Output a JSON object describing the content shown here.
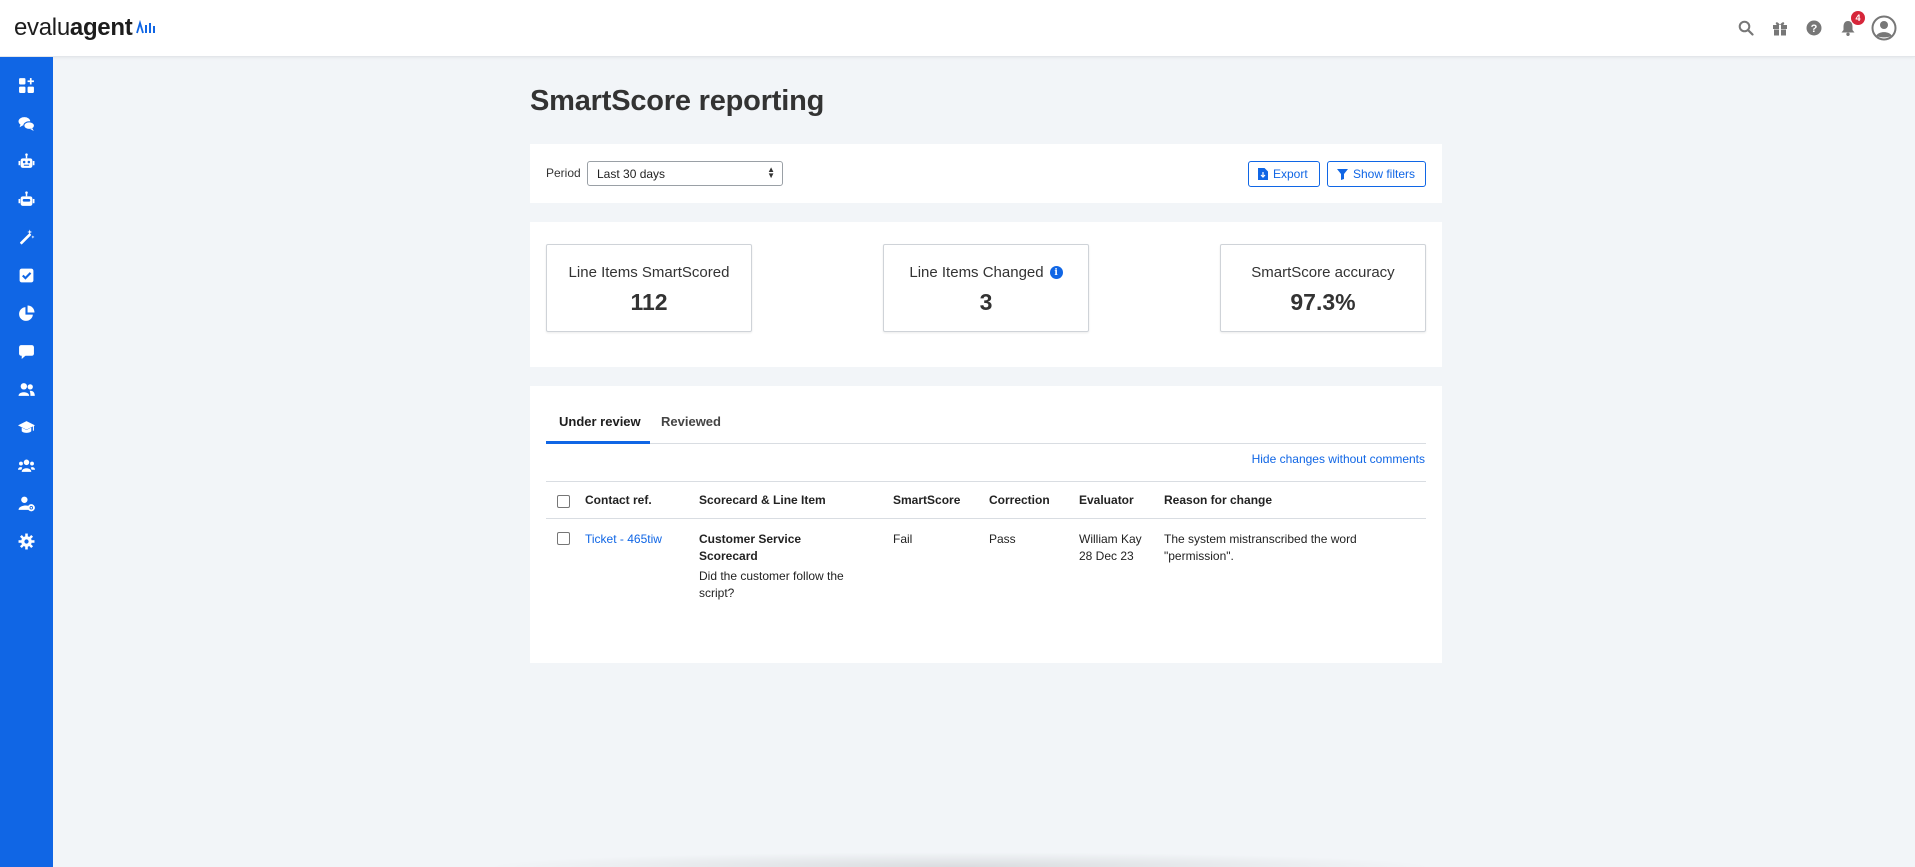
{
  "app": {
    "logo_text_regular": "evalu",
    "logo_text_bold": "agent",
    "brand_color": "#1066e5",
    "notification_count": "4"
  },
  "topbar": {
    "icons": [
      "search-icon",
      "gift-icon",
      "help-icon",
      "bell-icon",
      "user-avatar-icon"
    ]
  },
  "sidebar": {
    "items": [
      {
        "icon": "dashboard-add-icon"
      },
      {
        "icon": "conversations-icon"
      },
      {
        "icon": "robot-icon"
      },
      {
        "icon": "robot-alt-icon"
      },
      {
        "icon": "magic-wand-icon"
      },
      {
        "icon": "checkbox-icon"
      },
      {
        "icon": "pie-chart-icon"
      },
      {
        "icon": "comment-icon"
      },
      {
        "icon": "users-icon"
      },
      {
        "icon": "graduation-cap-icon"
      },
      {
        "icon": "team-icon"
      },
      {
        "icon": "user-settings-icon"
      },
      {
        "icon": "settings-gear-icon"
      }
    ]
  },
  "page": {
    "title": "SmartScore reporting"
  },
  "filters": {
    "period_label": "Period",
    "period_value": "Last 30 days",
    "export_label": "Export",
    "show_filters_label": "Show filters"
  },
  "stats": [
    {
      "label": "Line Items SmartScored",
      "value": "112"
    },
    {
      "label": "Line Items Changed",
      "value": "3",
      "info": true
    },
    {
      "label": "SmartScore accuracy",
      "value": "97.3%"
    }
  ],
  "tabs": {
    "under_review": "Under review",
    "reviewed": "Reviewed"
  },
  "hide_link": "Hide changes without comments",
  "table": {
    "headers": [
      "Contact ref.",
      "Scorecard & Line Item",
      "SmartScore",
      "Correction",
      "Evaluator",
      "Reason for change"
    ],
    "rows": [
      {
        "contact_ref": "Ticket - 465tiw",
        "scorecard": "Customer Service Scorecard",
        "line_item": "Did the customer follow the script?",
        "smartscore": "Fail",
        "correction": "Pass",
        "evaluator": "William Kay",
        "date": "28 Dec 23",
        "reason": "The system mistranscribed the word \"permission\"."
      }
    ]
  }
}
